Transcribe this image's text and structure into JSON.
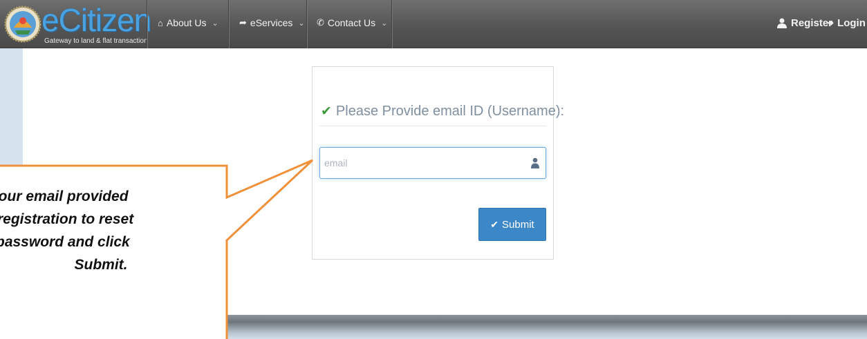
{
  "brand": {
    "name": "eCitizen",
    "tagline": "Gateway to land & flat transaction"
  },
  "nav": {
    "items": [
      {
        "label": "About Us",
        "icon": "home-icon"
      },
      {
        "label": "eServices",
        "icon": "share-arrow-icon"
      },
      {
        "label": "Contact Us",
        "icon": "phone-icon"
      }
    ],
    "register": "Register",
    "login": "Login"
  },
  "form": {
    "title": "Please Provide email ID (Username):",
    "email_placeholder": "email",
    "email_value": "",
    "submit_label": "Submit"
  },
  "callout": {
    "lines": [
      "your email provided",
      "registration to reset",
      "password and click",
      "Submit."
    ]
  },
  "colors": {
    "brand_blue": "#4aa3e0",
    "navbar": "#555555",
    "submit": "#3c87c7",
    "check_green": "#3c9a3c",
    "callout_border": "#f0913a"
  }
}
